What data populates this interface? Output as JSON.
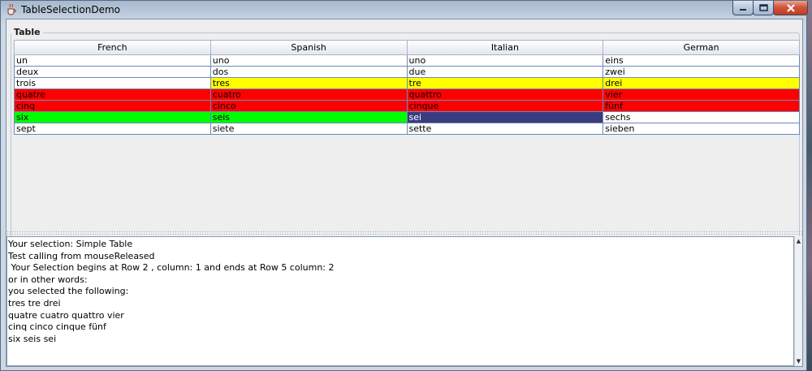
{
  "window": {
    "title": "TableSelectionDemo"
  },
  "group": {
    "title": "Table"
  },
  "table": {
    "columns": [
      "French",
      "Spanish",
      "Italian",
      "German"
    ],
    "rows": [
      [
        "un",
        "uno",
        "uno",
        "eins"
      ],
      [
        "deux",
        "dos",
        "due",
        "zwei"
      ],
      [
        "trois",
        "tres",
        "tre",
        "drei"
      ],
      [
        "quatre",
        "cuatro",
        "quattro",
        "vier"
      ],
      [
        "cinq",
        "cinco",
        "cinque",
        "fünf"
      ],
      [
        "six",
        "seis",
        "sei",
        "sechs"
      ],
      [
        "sept",
        "siete",
        "sette",
        "sieben"
      ]
    ],
    "cell_colors": {
      "selected_yellow": "#ffff00",
      "selected_red": "#ff0000",
      "selected_green": "#00ff00",
      "focus_blue": "#3b3c7f",
      "normal": "#ffffff"
    }
  },
  "output": {
    "lines": [
      "Your selection: Simple Table",
      "Test calling from mouseReleased",
      " Your Selection begins at Row 2 , column: 1 and ends at Row 5 column: 2",
      "or in other words:",
      "you selected the following:",
      "tres tre drei",
      "quatre cuatro quattro vier",
      "cinq cinco cinque fünf",
      "six seis sei"
    ]
  },
  "icons": {
    "app": "java-cup-icon",
    "minimize": "minimize-icon",
    "maximize": "maximize-icon",
    "close": "close-icon"
  }
}
